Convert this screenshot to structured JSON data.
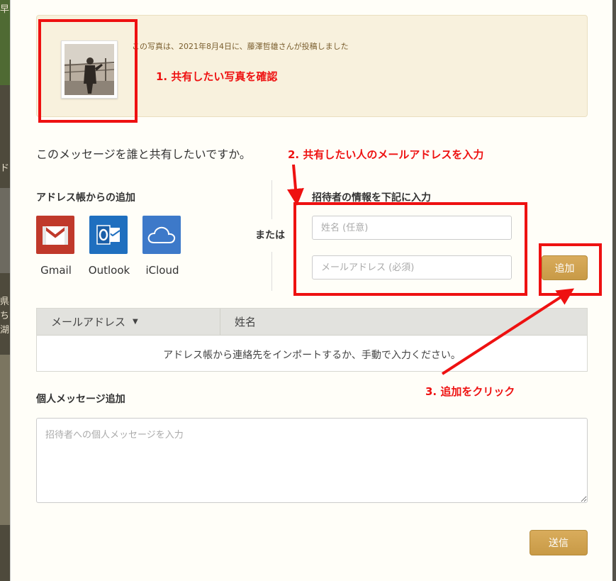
{
  "background": {
    "left_chars": [
      "早",
      "ド",
      "県",
      "ち",
      "湖"
    ]
  },
  "photo": {
    "caption": "この写真は、2021年8月4日に、藤澤哲雄さんが投稿しました"
  },
  "share": {
    "question": "このメッセージを誰と共有したいですか。"
  },
  "address_book": {
    "title": "アドレス帳からの追加",
    "services": [
      {
        "label": "Gmail",
        "icon": "gmail-icon",
        "color": "#c0392b"
      },
      {
        "label": "Outlook",
        "icon": "outlook-icon",
        "color": "#1f6fbf"
      },
      {
        "label": "iCloud",
        "icon": "icloud-icon",
        "color": "#3d79c9"
      }
    ]
  },
  "or_label": "または",
  "invite": {
    "title": "招待者の情報を下記に入力",
    "name_placeholder": "姓名 (任意)",
    "email_placeholder": "メールアドレス (必須)",
    "add_button": "追加"
  },
  "table": {
    "columns": [
      "メールアドレス",
      "姓名"
    ],
    "empty_message": "アドレス帳から連絡先をインポートするか、手動で入力ください。"
  },
  "personal_message": {
    "title": "個人メッセージ追加",
    "placeholder": "招待者への個人メッセージを入力"
  },
  "send_button": "送信",
  "annotations": {
    "step1": "1.  共有したい写真を確認",
    "step2": "2.  共有したい人のメールアドレスを入力",
    "step3": "3. 追加をクリック"
  },
  "colors": {
    "annotation": "#ee1111",
    "button": "#d4a653",
    "photo_box": "#f8f1dd"
  }
}
